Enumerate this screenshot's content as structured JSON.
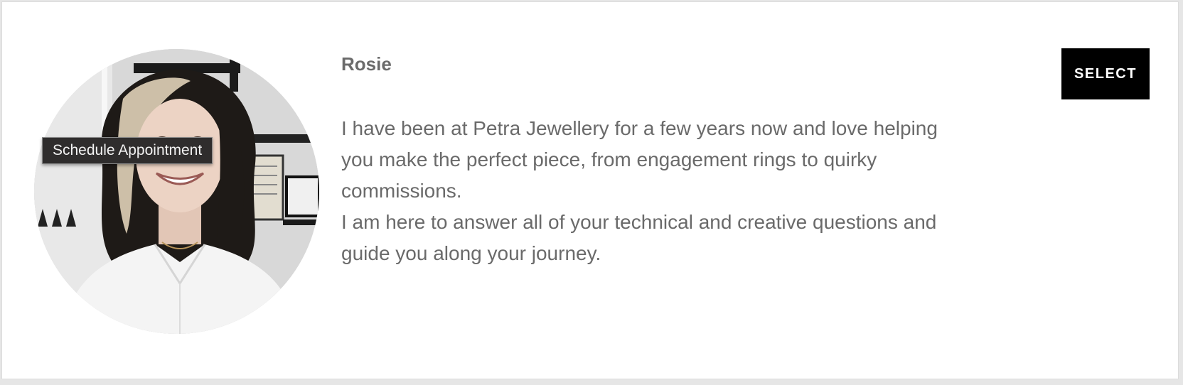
{
  "profile": {
    "name": "Rosie",
    "bio_line_1": "I have been at Petra Jewellery for a few years now and love helping you make the perfect piece, from engagement rings to quirky commissions.",
    "bio_line_2": "I am here to answer all of your technical and creative questions and guide you along your journey.",
    "photo_icon": "person-photo"
  },
  "tooltip": {
    "text": "Schedule Appointment"
  },
  "actions": {
    "select_label": "SELECT"
  },
  "colors": {
    "button_bg": "#000000",
    "button_text": "#ffffff",
    "text": "#6a6a6a",
    "tooltip_bg": "#2f2d2d"
  }
}
